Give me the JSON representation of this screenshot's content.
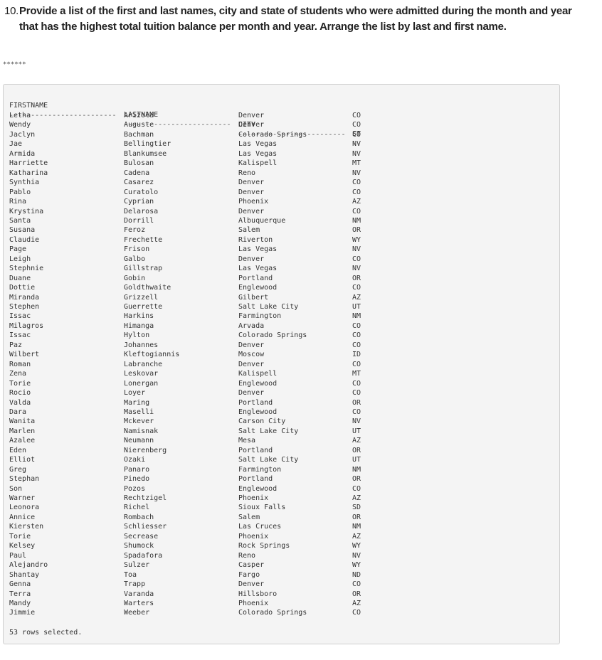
{
  "question": {
    "number": "10.",
    "line1": "Provide a list of the first and last names, city and state of students who were admitted during the month and year",
    "line2": "that has the highest total tuition balance per month and year. Arrange the list by last and first name."
  },
  "separator_stars": "******",
  "result": {
    "columns": [
      "FIRSTNAME",
      "LASTNAME",
      "CITY",
      "ST"
    ],
    "separators": [
      "-------------------------",
      "-------------------------",
      "-------------------------",
      "--"
    ],
    "rows": [
      [
        "Letha",
        "Arizola",
        "Denver",
        "CO"
      ],
      [
        "Wendy",
        "Auguste",
        "Denver",
        "CO"
      ],
      [
        "Jaclyn",
        "Bachman",
        "Colorado Springs",
        "CO"
      ],
      [
        "Jae",
        "Bellingtier",
        "Las Vegas",
        "NV"
      ],
      [
        "Armida",
        "Blankumsee",
        "Las Vegas",
        "NV"
      ],
      [
        "Harriette",
        "Bulosan",
        "Kalispell",
        "MT"
      ],
      [
        "Katharina",
        "Cadena",
        "Reno",
        "NV"
      ],
      [
        "Synthia",
        "Casarez",
        "Denver",
        "CO"
      ],
      [
        "Pablo",
        "Curatolo",
        "Denver",
        "CO"
      ],
      [
        "Rina",
        "Cyprian",
        "Phoenix",
        "AZ"
      ],
      [
        "Krystina",
        "Delarosa",
        "Denver",
        "CO"
      ],
      [
        "Santa",
        "Dorrill",
        "Albuquerque",
        "NM"
      ],
      [
        "Susana",
        "Feroz",
        "Salem",
        "OR"
      ],
      [
        "Claudie",
        "Frechette",
        "Riverton",
        "WY"
      ],
      [
        "Page",
        "Frison",
        "Las Vegas",
        "NV"
      ],
      [
        "Leigh",
        "Galbo",
        "Denver",
        "CO"
      ],
      [
        "Stephnie",
        "Gillstrap",
        "Las Vegas",
        "NV"
      ],
      [
        "Duane",
        "Gobin",
        "Portland",
        "OR"
      ],
      [
        "Dottie",
        "Goldthwaite",
        "Englewood",
        "CO"
      ],
      [
        "Miranda",
        "Grizzell",
        "Gilbert",
        "AZ"
      ],
      [
        "Stephen",
        "Guerrette",
        "Salt Lake City",
        "UT"
      ],
      [
        "Issac",
        "Harkins",
        "Farmington",
        "NM"
      ],
      [
        "Milagros",
        "Himanga",
        "Arvada",
        "CO"
      ],
      [
        "Issac",
        "Hylton",
        "Colorado Springs",
        "CO"
      ],
      [
        "Paz",
        "Johannes",
        "Denver",
        "CO"
      ],
      [
        "Wilbert",
        "Kleftogiannis",
        "Moscow",
        "ID"
      ],
      [
        "Roman",
        "Labranche",
        "Denver",
        "CO"
      ],
      [
        "Zena",
        "Leskovar",
        "Kalispell",
        "MT"
      ],
      [
        "Torie",
        "Lonergan",
        "Englewood",
        "CO"
      ],
      [
        "Rocio",
        "Loyer",
        "Denver",
        "CO"
      ],
      [
        "Valda",
        "Maring",
        "Portland",
        "OR"
      ],
      [
        "Dara",
        "Maselli",
        "Englewood",
        "CO"
      ],
      [
        "Wanita",
        "Mckever",
        "Carson City",
        "NV"
      ],
      [
        "Marlen",
        "Namisnak",
        "Salt Lake City",
        "UT"
      ],
      [
        "Azalee",
        "Neumann",
        "Mesa",
        "AZ"
      ],
      [
        "Eden",
        "Nierenberg",
        "Portland",
        "OR"
      ],
      [
        "Elliot",
        "Ozaki",
        "Salt Lake City",
        "UT"
      ],
      [
        "Greg",
        "Panaro",
        "Farmington",
        "NM"
      ],
      [
        "Stephan",
        "Pinedo",
        "Portland",
        "OR"
      ],
      [
        "Son",
        "Pozos",
        "Englewood",
        "CO"
      ],
      [
        "Warner",
        "Rechtzigel",
        "Phoenix",
        "AZ"
      ],
      [
        "Leonora",
        "Richel",
        "Sioux Falls",
        "SD"
      ],
      [
        "Annice",
        "Rombach",
        "Salem",
        "OR"
      ],
      [
        "Kiersten",
        "Schliesser",
        "Las Cruces",
        "NM"
      ],
      [
        "Torie",
        "Secrease",
        "Phoenix",
        "AZ"
      ],
      [
        "Kelsey",
        "Shumock",
        "Rock Springs",
        "WY"
      ],
      [
        "Paul",
        "Spadafora",
        "Reno",
        "NV"
      ],
      [
        "Alejandro",
        "Sulzer",
        "Casper",
        "WY"
      ],
      [
        "Shantay",
        "Toa",
        "Fargo",
        "ND"
      ],
      [
        "Genna",
        "Trapp",
        "Denver",
        "CO"
      ],
      [
        "Terra",
        "Varanda",
        "Hillsboro",
        "OR"
      ],
      [
        "Mandy",
        "Warters",
        "Phoenix",
        "AZ"
      ],
      [
        "Jimmie",
        "Weeber",
        "Colorado Springs",
        "CO"
      ]
    ],
    "footer": "53 rows selected."
  }
}
